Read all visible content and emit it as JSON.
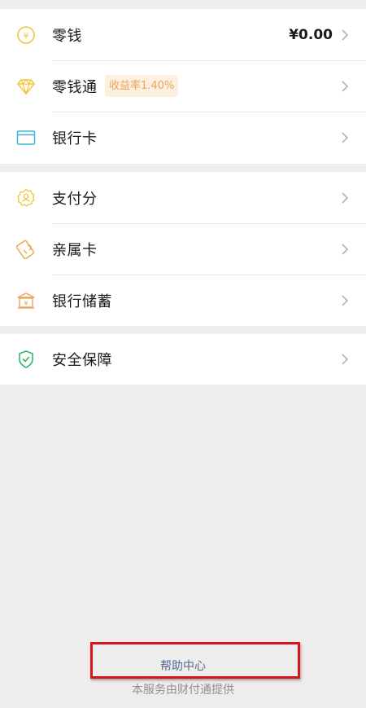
{
  "colors": {
    "page_background": "#ededed",
    "card_background": "#ffffff",
    "coin_icon": "#f2c535",
    "bank_card_icon": "#3ab5d6",
    "pay_score_icon": "#f2c535",
    "family_card_icon": "#f0a944",
    "bank_savings_icon": "#e8a65b",
    "security_icon": "#2fb567",
    "badge_text": "#e8a65b",
    "badge_background": "#fdf0e1",
    "help_link": "#576b95",
    "highlight_border": "#d9141b"
  },
  "groups": [
    {
      "items": [
        {
          "icon": "yuan-coin-icon",
          "label": "零钱",
          "value": "¥0.00"
        },
        {
          "icon": "diamond-icon",
          "label": "零钱通",
          "badge": "收益率1.40%"
        },
        {
          "icon": "bank-card-icon",
          "label": "银行卡"
        }
      ]
    },
    {
      "items": [
        {
          "icon": "pay-score-badge-icon",
          "label": "支付分"
        },
        {
          "icon": "family-card-icon",
          "label": "亲属卡"
        },
        {
          "icon": "bank-building-icon",
          "label": "银行储蓄"
        }
      ]
    },
    {
      "items": [
        {
          "icon": "shield-check-icon",
          "label": "安全保障"
        }
      ]
    }
  ],
  "footer": {
    "help_center": "帮助中心",
    "provider_note": "本服务由财付通提供"
  }
}
